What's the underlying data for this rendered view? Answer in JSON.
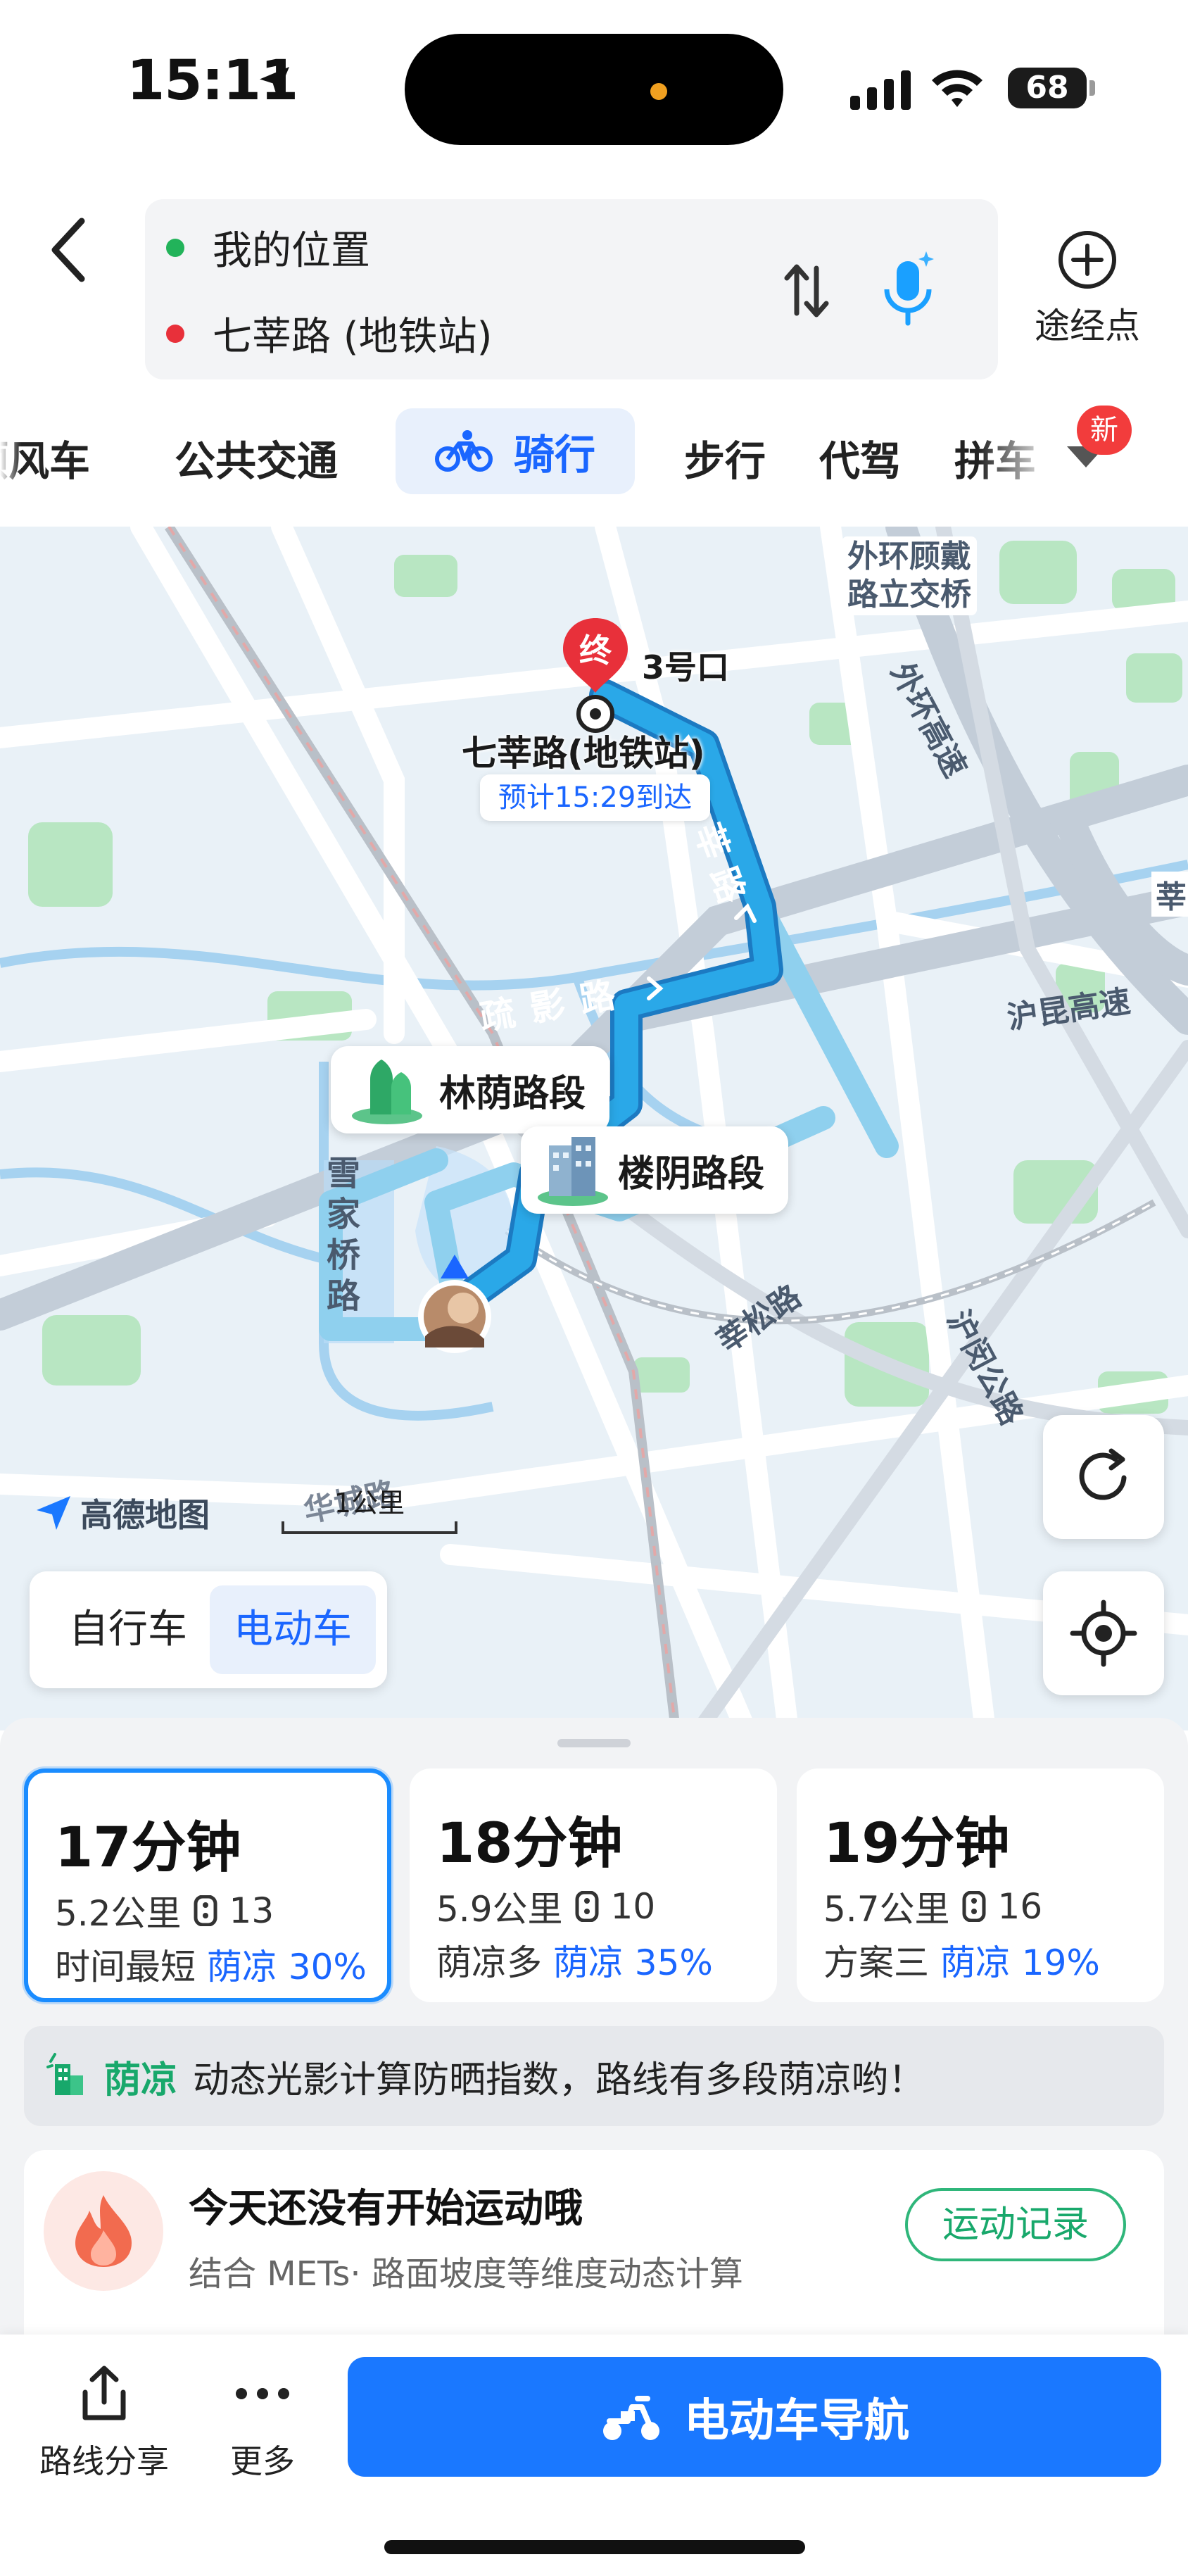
{
  "status_bar": {
    "time": "15:11",
    "battery": "68"
  },
  "header": {
    "origin": "我的位置",
    "destination": "七莘路 (地铁站)",
    "waypoint_label": "途经点"
  },
  "mode_tabs": {
    "items": [
      "顺风车",
      "公共交通",
      "骑行",
      "步行",
      "代驾",
      "拼车"
    ],
    "active": "骑行",
    "new_badge": "新"
  },
  "map": {
    "end_marker": "终",
    "exit_label": "3号口",
    "destination_label": "七莘路(地铁站)",
    "eta_chip": "预计15:29到达",
    "bubble_forest": "林荫路段",
    "bubble_building": "楼阴路段",
    "road_labels": {
      "interchange": [
        "外环顾戴",
        "路立交桥"
      ],
      "outer_ring": "外环高速",
      "hukun": "沪昆高速",
      "shuying": "疏影路",
      "qixin": "莘路",
      "xuejiaqiao": "雪家桥路",
      "xinsong": "莘松路",
      "humin": "沪闵公路",
      "edge_xin": "莘",
      "bottom_road": "华城路"
    },
    "logo": "高德地图",
    "scale": "1公里",
    "vehicle_options": [
      "自行车",
      "电动车"
    ],
    "vehicle_selected": "电动车"
  },
  "routes": [
    {
      "time": "17分钟",
      "distance": "5.2公里",
      "lights": "13",
      "tag": "时间最短",
      "shade": "荫凉 30%",
      "selected": true
    },
    {
      "time": "18分钟",
      "distance": "5.9公里",
      "lights": "10",
      "tag": "荫凉多",
      "shade": "荫凉 35%",
      "selected": false
    },
    {
      "time": "19分钟",
      "distance": "5.7公里",
      "lights": "16",
      "tag": "方案三",
      "shade": "荫凉 19%",
      "selected": false
    }
  ],
  "shade_banner": {
    "keyword": "荫凉",
    "text": "动态光影计算防晒指数，路线有多段荫凉哟！"
  },
  "fitness": {
    "title": "今天还没有开始运动哦",
    "subtitle": "结合 METs· 路面坡度等维度动态计算",
    "button": "运动记录"
  },
  "actions": {
    "share": "路线分享",
    "more": "更多",
    "navigate": "电动车导航"
  },
  "colors": {
    "accent": "#1a78ff",
    "route": "#2aa8e8",
    "shade_green": "#18a86b",
    "end_pin": "#e8303a"
  }
}
